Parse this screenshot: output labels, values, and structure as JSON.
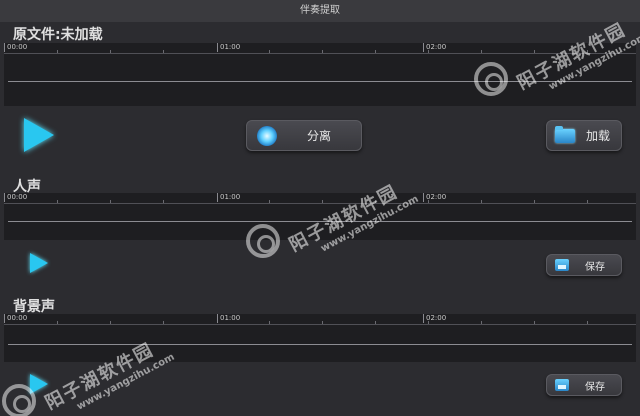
{
  "window": {
    "title": "伴奏提取"
  },
  "original": {
    "label": "原文件:未加载",
    "ticks": [
      "00:00",
      "01:00",
      "02:00"
    ],
    "split_label": "分离",
    "load_label": "加载"
  },
  "vocals": {
    "label": "人声",
    "ticks": [
      "00:00",
      "01:00",
      "02:00"
    ],
    "save_label": "保存"
  },
  "background": {
    "label": "背景声",
    "ticks": [
      "00:00",
      "01:00",
      "02:00"
    ],
    "save_label": "保存"
  },
  "watermark": {
    "title": "阳子湖软件园",
    "url": "www.yangzihu.com"
  },
  "colors": {
    "accent": "#29c7f0",
    "waveform_bg": "#1e1e21",
    "window_bg": "#2c2c30"
  }
}
